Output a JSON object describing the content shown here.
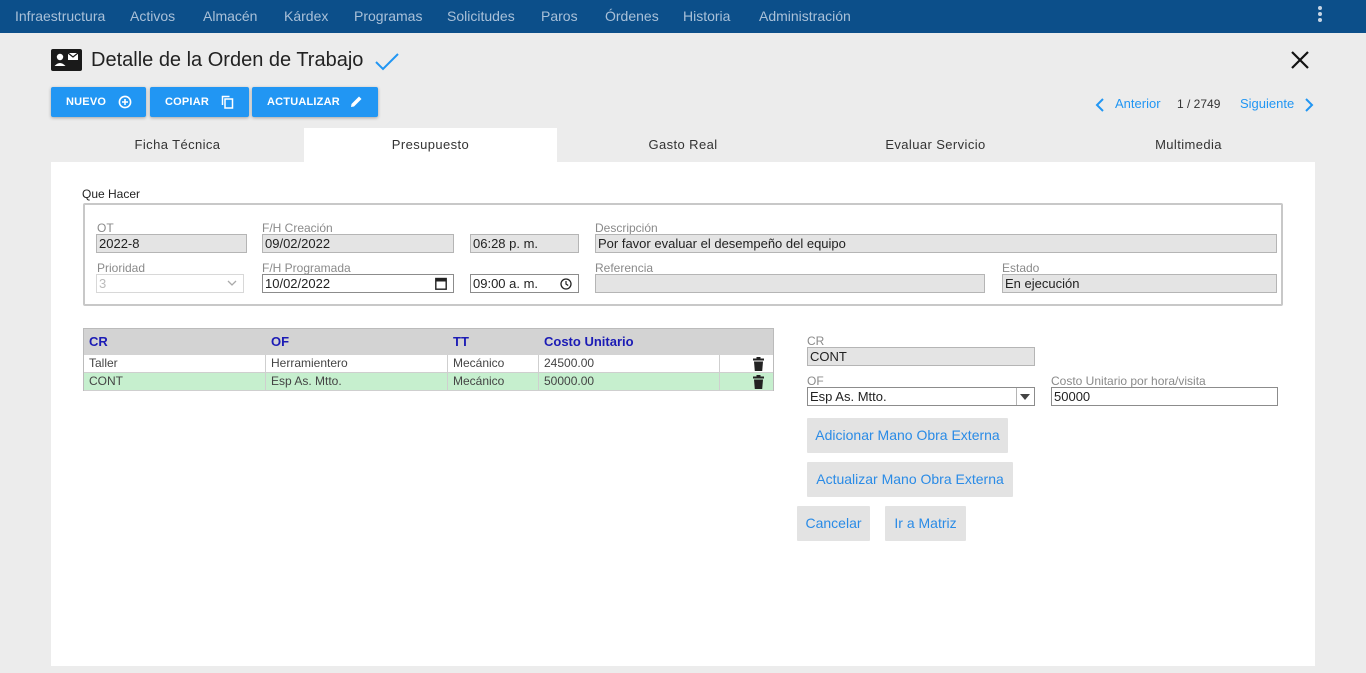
{
  "nav": {
    "items": [
      "Infraestructura",
      "Activos",
      "Almacén",
      "Kárdex",
      "Programas",
      "Solicitudes",
      "Paros",
      "Órdenes",
      "Historia",
      "Administración"
    ]
  },
  "header": {
    "title": "Detalle de la Orden de Trabajo"
  },
  "toolbar": {
    "new_label": "NUEVO",
    "copy_label": "COPIAR",
    "update_label": "ACTUALIZAR"
  },
  "pager": {
    "prev_label": "Anterior",
    "position": "1 / 2749",
    "next_label": "Siguiente"
  },
  "tabs": [
    "Ficha Técnica",
    "Presupuesto",
    "Gasto Real",
    "Evaluar Servicio",
    "Multimedia"
  ],
  "que_hacer": {
    "section_label": "Que Hacer",
    "ot": {
      "label": "OT",
      "value": "2022-8"
    },
    "fh_creacion": {
      "label": "F/H Creación",
      "date": "09/02/2022",
      "time": "06:28 p. m."
    },
    "descripcion": {
      "label": "Descripción",
      "value": "Por favor evaluar el desempeño del equipo"
    },
    "prioridad": {
      "label": "Prioridad",
      "value": "3"
    },
    "fh_programada": {
      "label": "F/H Programada",
      "date": "10/02/2022",
      "time": "09:00 a. m."
    },
    "referencia": {
      "label": "Referencia",
      "value": ""
    },
    "estado": {
      "label": "Estado",
      "value": "En ejecución"
    }
  },
  "grid": {
    "columns": [
      "CR",
      "OF",
      "TT",
      "Costo Unitario"
    ],
    "rows": [
      {
        "cr": "Taller",
        "of": "Herramientero",
        "tt": "Mecánico",
        "costo": "24500.00"
      },
      {
        "cr": "CONT",
        "of": "Esp As. Mtto.",
        "tt": "Mecánico",
        "costo": "50000.00"
      }
    ]
  },
  "edit_form": {
    "cr": {
      "label": "CR",
      "value": "CONT"
    },
    "of": {
      "label": "OF",
      "value": "Esp As. Mtto."
    },
    "costo": {
      "label": "Costo Unitario por hora/visita",
      "value": "50000"
    },
    "add_label": "Adicionar Mano Obra Externa",
    "update_label": "Actualizar Mano Obra Externa",
    "cancel_label": "Cancelar",
    "matrix_label": "Ir a Matriz"
  },
  "colors": {
    "nav_bg": "#0c4f8a",
    "accent": "#2196f3",
    "selected_row": "#c6efce"
  },
  "icons": [
    "id-card-icon",
    "check-icon",
    "close-icon",
    "plus-circle-icon",
    "copy-icon",
    "pencil-icon",
    "chevron-left-icon",
    "chevron-right-icon",
    "calendar-icon",
    "clock-icon",
    "dropdown-arrow-icon",
    "trash-icon",
    "more-vert-icon"
  ]
}
